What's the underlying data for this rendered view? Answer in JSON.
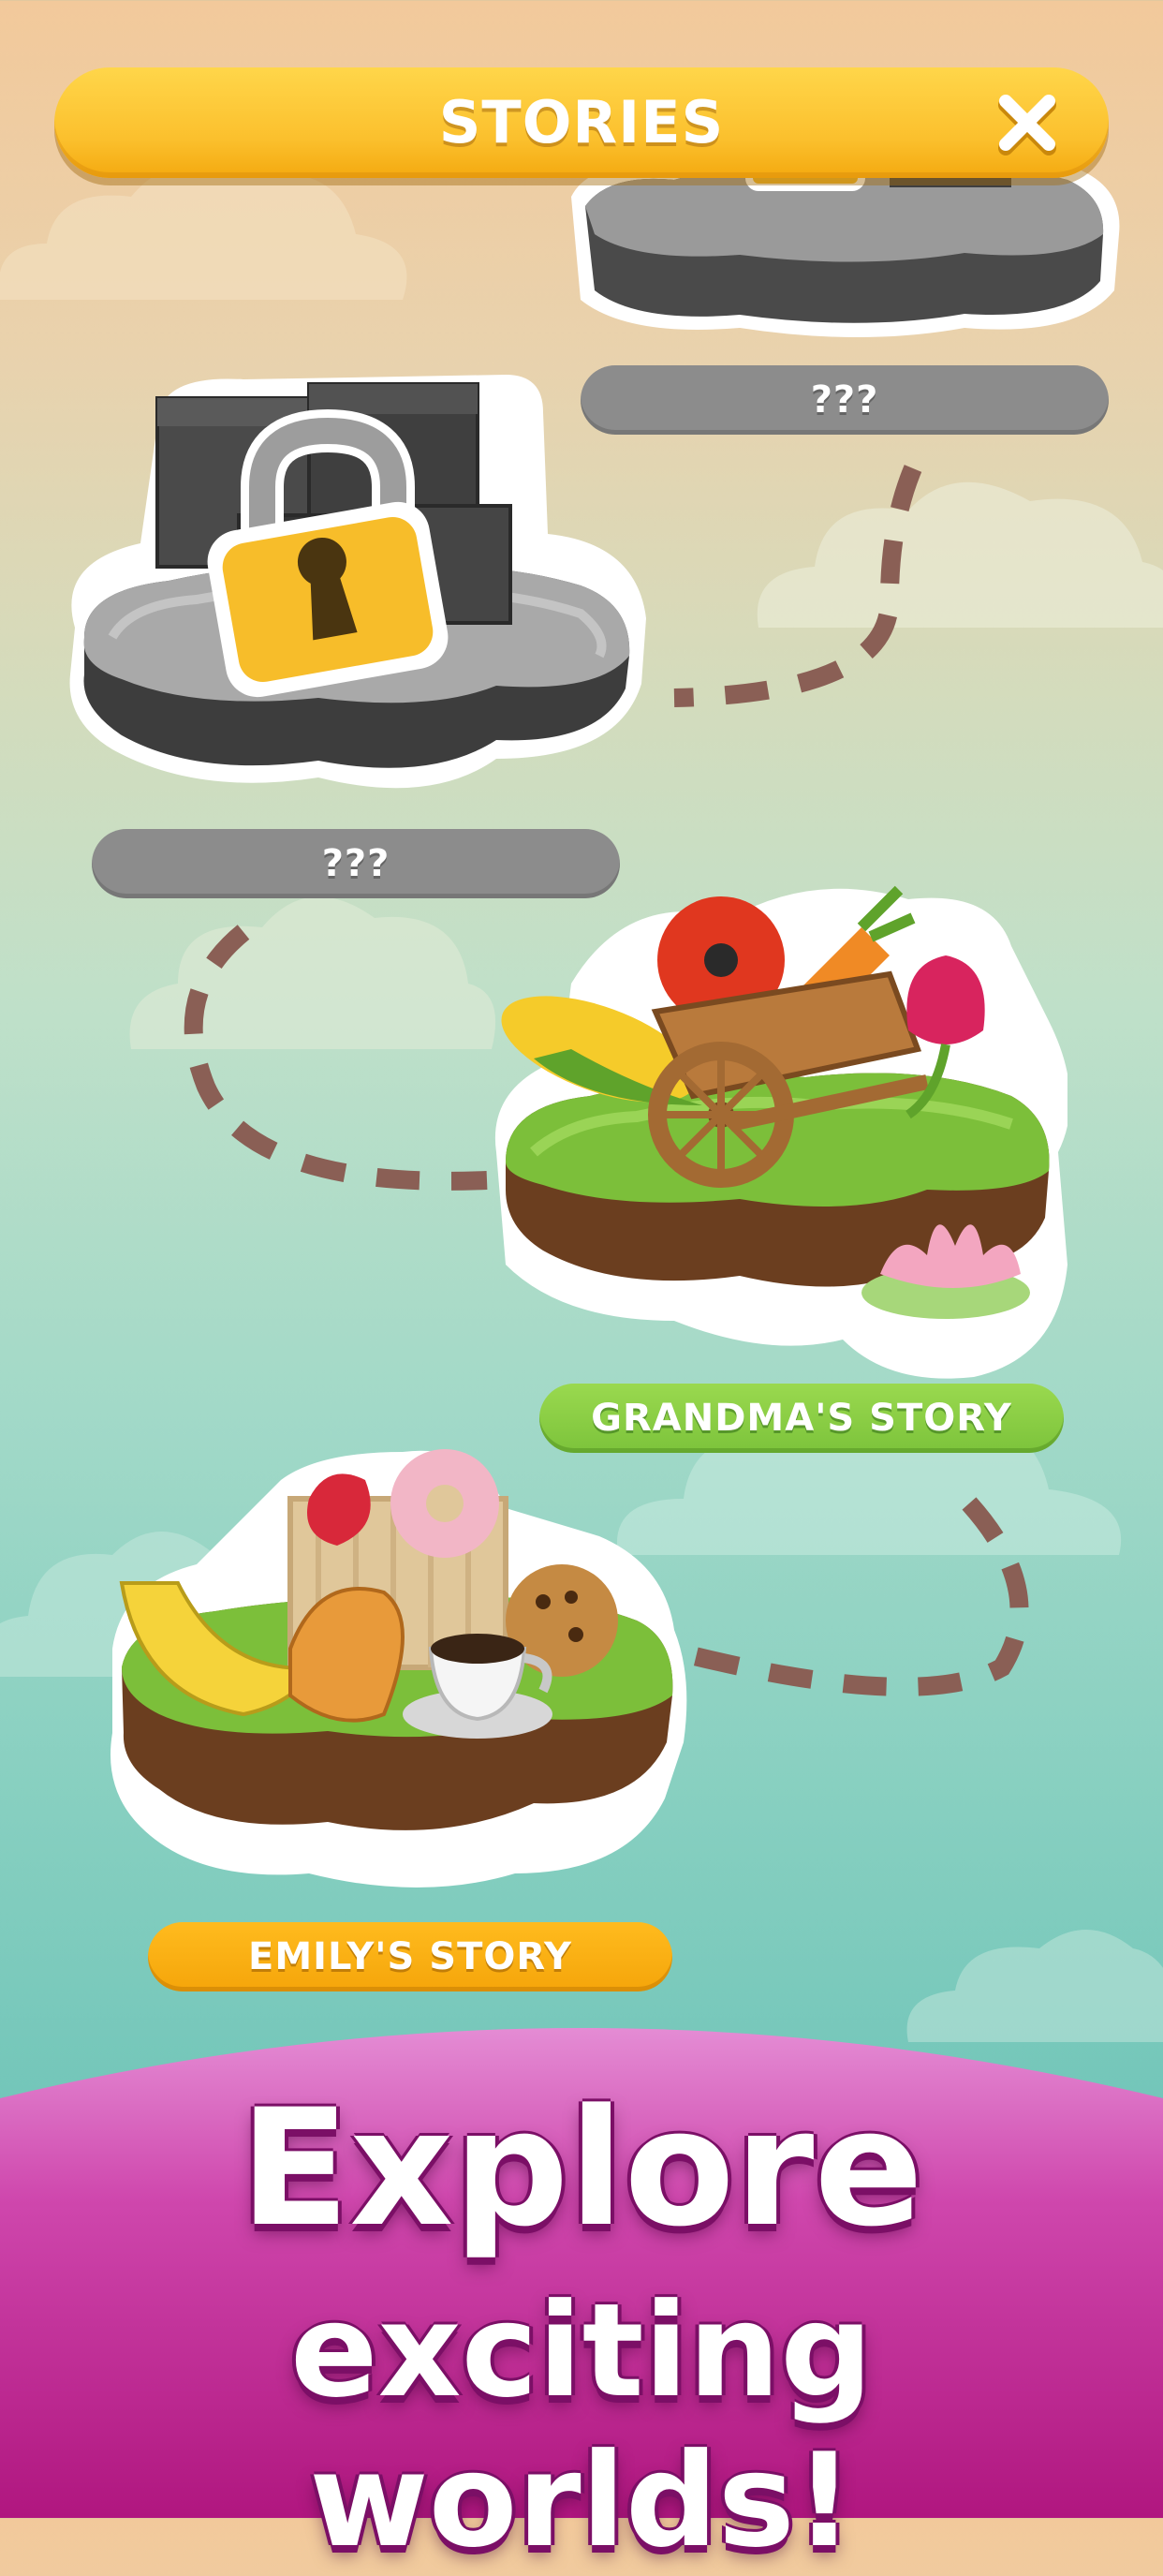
{
  "header": {
    "title": "STORIES",
    "close_icon": "close-icon"
  },
  "stories": [
    {
      "id": "locked-top",
      "label": "???",
      "state": "locked"
    },
    {
      "id": "locked-middle",
      "label": "???",
      "state": "locked"
    },
    {
      "id": "grandmas-story",
      "label": "GRANDMA'S STORY",
      "state": "unlocked"
    },
    {
      "id": "emilys-story",
      "label": "EMILY'S STORY",
      "state": "current"
    }
  ],
  "banner": {
    "line1": "Explore",
    "line2": "exciting worlds!"
  },
  "colors": {
    "header_yellow": "#fbc02d",
    "locked_gray": "#8c8c8c",
    "grandma_green": "#7cc33b",
    "emily_orange": "#f5a50a",
    "banner_magenta": "#c21f98",
    "path_brown": "#8a5f55"
  }
}
